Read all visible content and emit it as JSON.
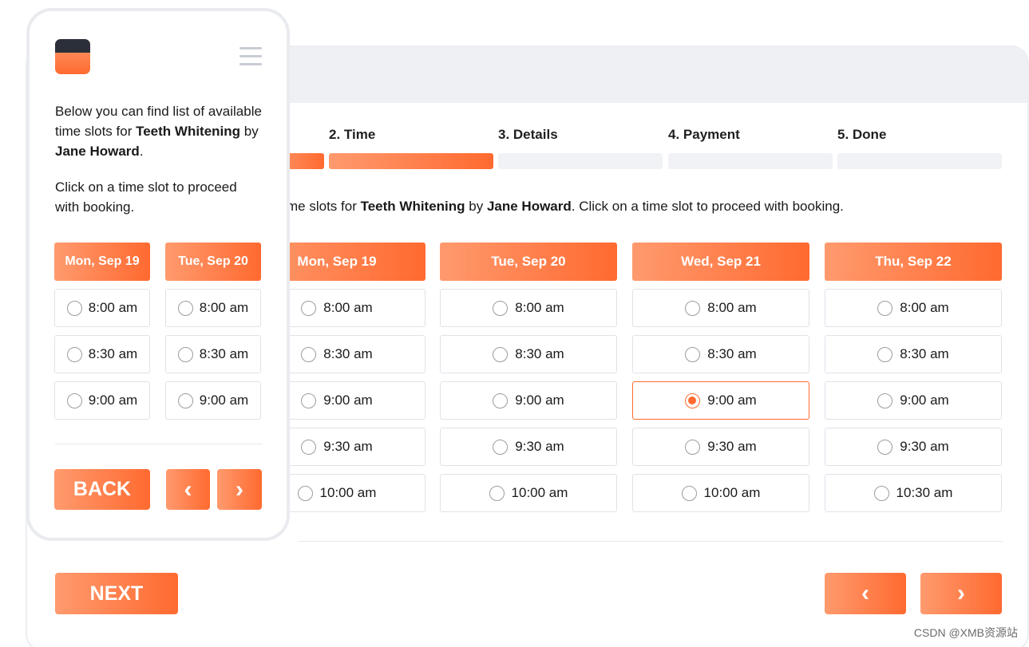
{
  "steps": [
    {
      "label": "2. Time",
      "done": true
    },
    {
      "label": "3. Details",
      "done": false
    },
    {
      "label": "4. Payment",
      "done": false
    },
    {
      "label": "5. Done",
      "done": false
    }
  ],
  "intro": {
    "prefix": "me slots for ",
    "service": "Teeth Whitening",
    "by": " by ",
    "staff": "Jane Howard",
    "suffix": ". Click on a time slot to proceed with booking."
  },
  "days": [
    {
      "label": "Mon, Sep 19",
      "slots": [
        "8:00 am",
        "8:30 am",
        "9:00 am",
        "9:30 am",
        "10:00 am"
      ]
    },
    {
      "label": "Tue, Sep 20",
      "slots": [
        "8:00 am",
        "8:30 am",
        "9:00 am",
        "9:30 am",
        "10:00 am"
      ]
    },
    {
      "label": "Wed, Sep 21",
      "slots": [
        "8:00 am",
        "8:30 am",
        "9:00 am",
        "9:30 am",
        "10:00 am"
      ]
    },
    {
      "label": "Thu, Sep 22",
      "slots": [
        "8:00 am",
        "8:30 am",
        "9:00 am",
        "9:30 am",
        "10:30 am"
      ]
    }
  ],
  "selected_slot": {
    "day": "Wed, Sep 21",
    "time": "9:00 am"
  },
  "buttons": {
    "next": "NEXT",
    "back": "BACK",
    "prev_icon": "‹",
    "next_icon": "›"
  },
  "mobile": {
    "intro_prefix": "Below you can find list of available time slots for ",
    "service": "Teeth Whitening",
    "by": " by ",
    "staff": "Jane Howard",
    "intro_suffix": ".",
    "instruction": "Click on a time slot to proceed with booking.",
    "days": [
      {
        "label": "Mon, Sep 19",
        "slots": [
          "8:00 am",
          "8:30 am",
          "9:00 am"
        ]
      },
      {
        "label": "Tue, Sep 20",
        "slots": [
          "8:00 am",
          "8:30 am",
          "9:00 am"
        ]
      }
    ]
  },
  "watermark": "CSDN @XMB资源站",
  "colors": {
    "accent": "#ff6a30",
    "accent_light": "#ff9a6e",
    "calendar_top": "#2b2f3a"
  }
}
